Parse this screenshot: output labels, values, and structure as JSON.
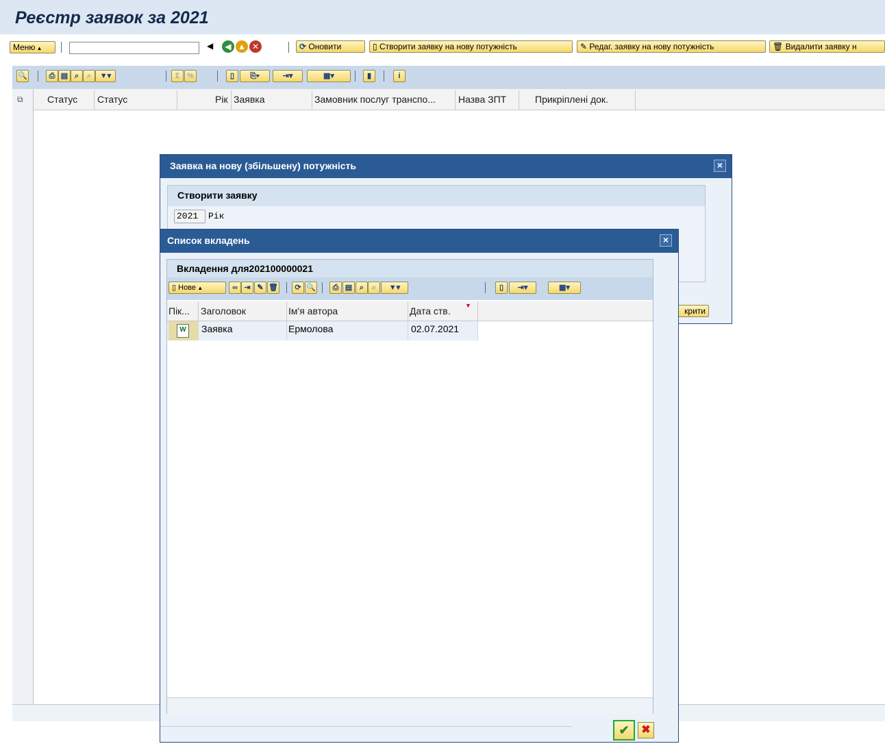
{
  "page": {
    "title": "Реєстр заявок за 2021"
  },
  "app_toolbar": {
    "menu_label": "Меню",
    "command_value": "",
    "refresh_label": "Оновити",
    "create_label": "Створити заявку на нову потужність",
    "edit_label": "Редаг. заявку на нову потужність",
    "delete_label": "Видалити заявку н"
  },
  "grid": {
    "columns": [
      "Статус",
      "Статус",
      "Рік",
      "Заявка",
      "Замовник послуг транспо...",
      "Назва ЗПТ",
      "Прикріплені док."
    ]
  },
  "dialog_request": {
    "title": "Заявка на нову (збільшену) потужність",
    "group_title": "Створити заявку",
    "year_value": "2021",
    "year_label": "Рік",
    "open_button_partial": "крити"
  },
  "dialog_attachments": {
    "title": "Список вкладень",
    "group_title": "Вкладення для202100000021",
    "new_button_label": "Нове",
    "columns": [
      "Пік...",
      "Заголовок",
      "Ім'я автора",
      "Дата ств."
    ],
    "rows": [
      {
        "title": "Заявка",
        "author": "Ермолова",
        "date": "02.07.2021"
      }
    ]
  },
  "colors": {
    "title_bar": "#dce7f3",
    "dialog_title": "#2b5b94",
    "button_yellow": "#f5d86a",
    "ok_border": "#1fa83a",
    "cancel_x": "#c81e1e"
  }
}
